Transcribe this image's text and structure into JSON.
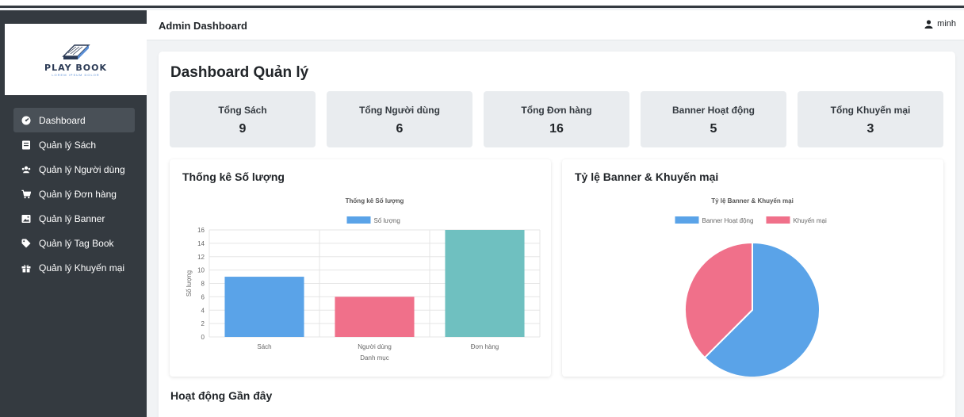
{
  "logo": {
    "title": "PLAY BOOK",
    "tagline": "LOREM IPSUM DOLOR"
  },
  "sidebar": {
    "items": [
      {
        "label": "Dashboard",
        "icon": "dashboard-icon",
        "active": true
      },
      {
        "label": "Quản lý Sách",
        "icon": "book-icon"
      },
      {
        "label": "Quản lý Người dùng",
        "icon": "users-icon"
      },
      {
        "label": "Quản lý Đơn hàng",
        "icon": "cart-icon"
      },
      {
        "label": "Quản lý Banner",
        "icon": "image-icon"
      },
      {
        "label": "Quản lý Tag Book",
        "icon": "tag-icon"
      },
      {
        "label": "Quản lý Khuyến mại",
        "icon": "gift-icon"
      }
    ]
  },
  "header": {
    "title": "Admin Dashboard",
    "user": "minh"
  },
  "main": {
    "title": "Dashboard Quản lý",
    "stats": [
      {
        "label": "Tổng Sách",
        "value": "9"
      },
      {
        "label": "Tổng Người dùng",
        "value": "6"
      },
      {
        "label": "Tổng Đơn hàng",
        "value": "16"
      },
      {
        "label": "Banner Hoạt động",
        "value": "5"
      },
      {
        "label": "Tổng Khuyến mại",
        "value": "3"
      }
    ],
    "bar_card_title": "Thống kê Số lượng",
    "pie_card_title": "Tỷ lệ Banner & Khuyến mại",
    "activity_title": "Hoạt động Gần đây"
  },
  "chart_data": [
    {
      "type": "bar",
      "title": "Thống kê Số lượng",
      "categories": [
        "Sách",
        "Người dùng",
        "Đơn hàng"
      ],
      "series": [
        {
          "name": "Số lượng",
          "values": [
            9,
            6,
            16
          ]
        }
      ],
      "colors": [
        "#5aa3e8",
        "#f0708a",
        "#6fc0c0"
      ],
      "legend_color": "#5aa3e8",
      "xlabel": "Danh mục",
      "ylabel": "Số lượng",
      "ylim": [
        0,
        16
      ],
      "yticks": [
        0,
        2,
        4,
        6,
        8,
        10,
        12,
        14,
        16
      ],
      "grid": true,
      "legend": "top"
    },
    {
      "type": "pie",
      "title": "Tỷ lệ Banner & Khuyến mại",
      "labels": [
        "Banner Hoạt động",
        "Khuyến mại"
      ],
      "values": [
        5,
        3
      ],
      "colors": [
        "#5aa3e8",
        "#f0708a"
      ],
      "legend": "top"
    }
  ]
}
